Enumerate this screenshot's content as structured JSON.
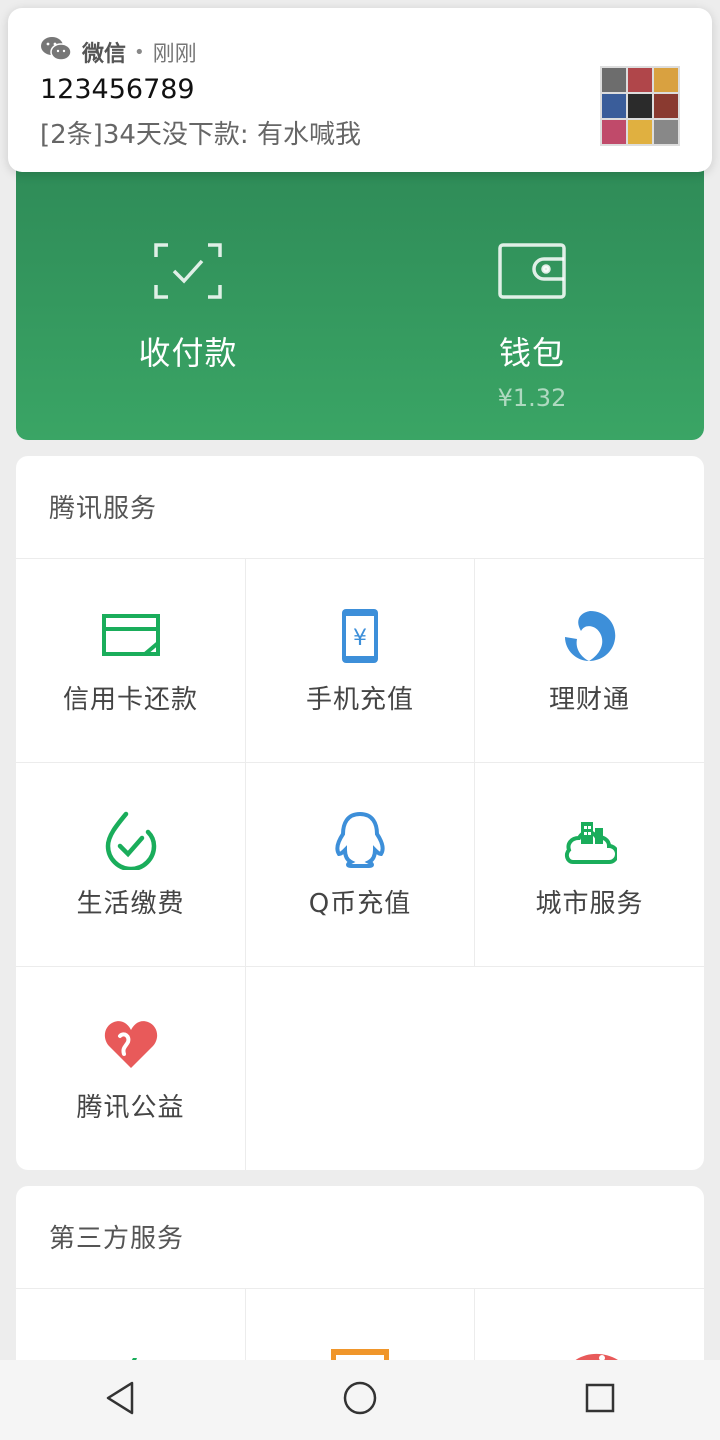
{
  "notification": {
    "app_name": "微信",
    "separator": "•",
    "time": "刚刚",
    "title": "123456789",
    "message": "[2条]34天没下款: 有水喊我"
  },
  "pay_card": {
    "collect": {
      "label": "收付款",
      "icon": "scan-pay-icon"
    },
    "wallet": {
      "label": "钱包",
      "balance": "¥1.32",
      "icon": "wallet-icon"
    }
  },
  "tencent_services": {
    "title": "腾讯服务",
    "items": [
      {
        "label": "信用卡还款",
        "icon": "credit-card-icon",
        "color": "#1aad5b"
      },
      {
        "label": "手机充值",
        "icon": "phone-recharge-icon",
        "color": "#3d8fd9"
      },
      {
        "label": "理财通",
        "icon": "wealth-icon",
        "color": "#3d8fd9"
      },
      {
        "label": "生活缴费",
        "icon": "utility-payment-icon",
        "color": "#1aad5b"
      },
      {
        "label": "Q币充值",
        "icon": "qq-icon",
        "color": "#3d8fd9"
      },
      {
        "label": "城市服务",
        "icon": "city-service-icon",
        "color": "#1aad5b"
      },
      {
        "label": "腾讯公益",
        "icon": "charity-heart-icon",
        "color": "#e85a5a"
      }
    ]
  },
  "third_party_services": {
    "title": "第三方服务",
    "items": [
      {
        "icon": "flight-icon",
        "color": "#1aad5b"
      },
      {
        "icon": "orange-box-icon",
        "color": "#f0962b"
      },
      {
        "icon": "fish-icon",
        "color": "#e85a5a"
      }
    ]
  },
  "navbar": {
    "back": "back-icon",
    "home": "home-icon",
    "recents": "recents-icon"
  }
}
